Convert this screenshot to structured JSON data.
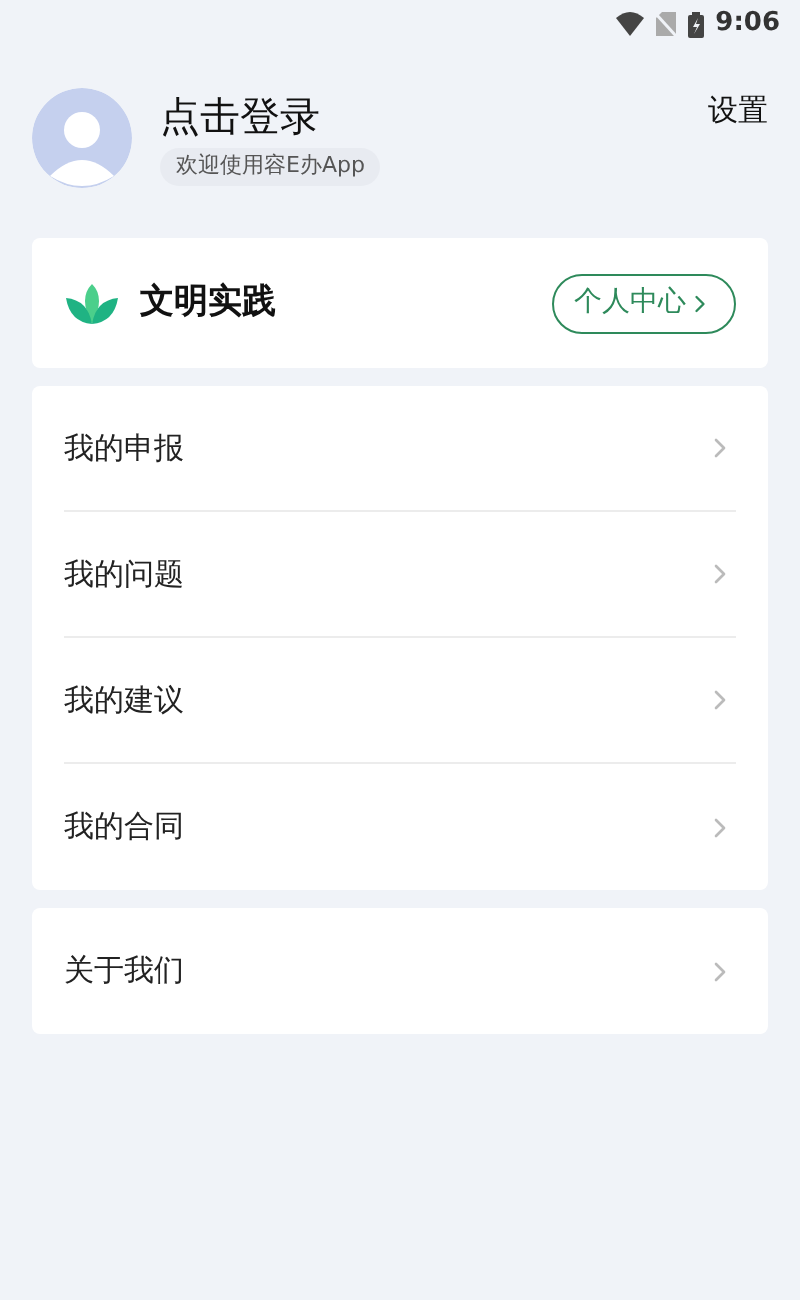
{
  "status_bar": {
    "time": "9:06"
  },
  "profile": {
    "title": "点击登录",
    "subtitle": "欢迎使用容E办App",
    "settings": "设置"
  },
  "feature_card": {
    "title": "文明实践",
    "button": "个人中心"
  },
  "menu": [
    {
      "label": "我的申报"
    },
    {
      "label": "我的问题"
    },
    {
      "label": "我的建议"
    },
    {
      "label": "我的合同"
    }
  ],
  "about": {
    "label": "关于我们"
  }
}
